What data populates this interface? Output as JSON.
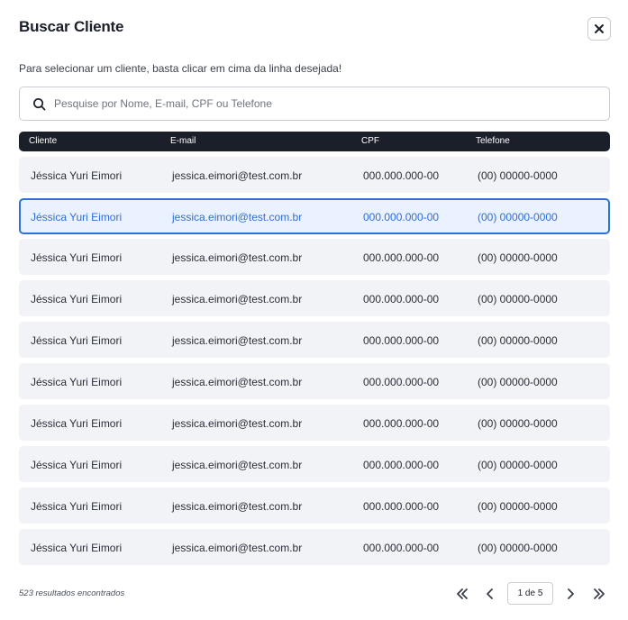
{
  "modal": {
    "title": "Buscar Cliente",
    "instructions": "Para selecionar um cliente, basta clicar em cima da linha desejada!"
  },
  "search": {
    "placeholder": "Pesquise por Nome, E-mail, CPF ou Telefone",
    "value": ""
  },
  "table": {
    "headers": [
      "Cliente",
      "E-mail",
      "CPF",
      "Telefone"
    ],
    "selected_index": 1,
    "rows": [
      {
        "name": "Jéssica Yuri Eimori",
        "email": "jessica.eimori@test.com.br",
        "cpf": "000.000.000-00",
        "phone": "(00) 00000-0000"
      },
      {
        "name": "Jéssica Yuri Eimori",
        "email": "jessica.eimori@test.com.br",
        "cpf": "000.000.000-00",
        "phone": "(00) 00000-0000"
      },
      {
        "name": "Jéssica Yuri Eimori",
        "email": "jessica.eimori@test.com.br",
        "cpf": "000.000.000-00",
        "phone": "(00) 00000-0000"
      },
      {
        "name": "Jéssica Yuri Eimori",
        "email": "jessica.eimori@test.com.br",
        "cpf": "000.000.000-00",
        "phone": "(00) 00000-0000"
      },
      {
        "name": "Jéssica Yuri Eimori",
        "email": "jessica.eimori@test.com.br",
        "cpf": "000.000.000-00",
        "phone": "(00) 00000-0000"
      },
      {
        "name": "Jéssica Yuri Eimori",
        "email": "jessica.eimori@test.com.br",
        "cpf": "000.000.000-00",
        "phone": "(00) 00000-0000"
      },
      {
        "name": "Jéssica Yuri Eimori",
        "email": "jessica.eimori@test.com.br",
        "cpf": "000.000.000-00",
        "phone": "(00) 00000-0000"
      },
      {
        "name": "Jéssica Yuri Eimori",
        "email": "jessica.eimori@test.com.br",
        "cpf": "000.000.000-00",
        "phone": "(00) 00000-0000"
      },
      {
        "name": "Jéssica Yuri Eimori",
        "email": "jessica.eimori@test.com.br",
        "cpf": "000.000.000-00",
        "phone": "(00) 00000-0000"
      },
      {
        "name": "Jéssica Yuri Eimori",
        "email": "jessica.eimori@test.com.br",
        "cpf": "000.000.000-00",
        "phone": "(00) 00000-0000"
      }
    ]
  },
  "footer": {
    "results_text": "523 resultados encontrados",
    "page_indicator": "1 de 5"
  },
  "icons": {
    "close": "close-icon",
    "search": "search-icon",
    "first": "chevron-double-left-icon",
    "prev": "chevron-left-icon",
    "next": "chevron-right-icon",
    "last": "chevron-double-right-icon"
  },
  "colors": {
    "header_bg": "#1b1f2a",
    "row_bg": "#f2f3f7",
    "selected_accent": "#2f6fd8",
    "selected_bg": "#eaf1ff"
  }
}
